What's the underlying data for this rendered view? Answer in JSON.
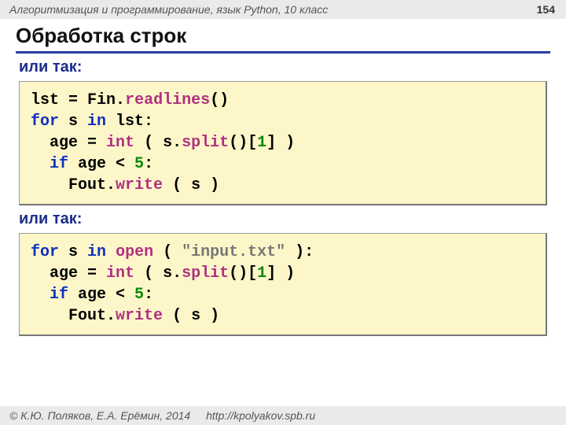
{
  "header": {
    "course": "Алгоритмизация и программирование, язык Python, 10 класс",
    "page": "154"
  },
  "title": "Обработка строк",
  "sub1": "или так:",
  "sub2": "или так:",
  "code1": {
    "t_lst": "lst",
    "t_eq1": " = ",
    "t_Fin": "Fin",
    "t_dot1": ".",
    "t_readlines": "readlines",
    "t_par1": "()",
    "t_for": "for",
    "t_s": " s ",
    "t_in": "in",
    "t_lst2": " lst:",
    "t_indent2": "  ",
    "t_age": "age",
    "t_eq2": " = ",
    "t_int": "int",
    "t_open": " ( s.",
    "t_split": "split",
    "t_mid": "()[",
    "t_one": "1",
    "t_tail": "] )",
    "t_indent3": "  ",
    "t_if": "if",
    "t_cond": " age < ",
    "t_five": "5",
    "t_colon": ":",
    "t_indent4": "    ",
    "t_Fout": "Fout",
    "t_dot2": ".",
    "t_write": "write",
    "t_wargs": " ( s )"
  },
  "code2": {
    "t_for": "for",
    "t_s": " s ",
    "t_in": "in",
    "t_sp": " ",
    "t_open": "open",
    "t_open2": " ( ",
    "t_str": "\"input.txt\"",
    "t_close": " ):",
    "t_indent2": "  ",
    "t_age": "age",
    "t_eq2": " = ",
    "t_int": "int",
    "t_par": " ( s.",
    "t_split": "split",
    "t_mid": "()[",
    "t_one": "1",
    "t_tail": "] )",
    "t_indent3": "  ",
    "t_if": "if",
    "t_cond": " age < ",
    "t_five": "5",
    "t_colon": ":",
    "t_indent4": "    ",
    "t_Fout": "Fout",
    "t_dot2": ".",
    "t_write": "write",
    "t_wargs": " ( s )"
  },
  "footer": {
    "copyright": "© К.Ю. Поляков, Е.А. Ерёмин, 2014",
    "url": "http://kpolyakov.spb.ru"
  }
}
